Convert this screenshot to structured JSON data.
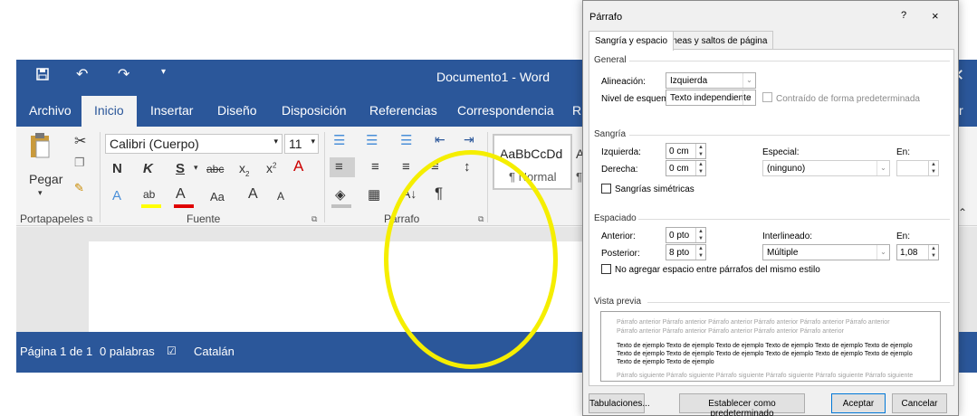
{
  "word": {
    "title": "Documento1 - Word",
    "quick_access": [
      "save-icon",
      "undo-icon",
      "redo-icon",
      "customize-icon"
    ],
    "tabs": [
      "Archivo",
      "Inicio",
      "Insertar",
      "Diseño",
      "Disposición",
      "Referencias",
      "Correspondencia",
      "R"
    ],
    "active_tab": "Inicio",
    "tab_overflow_text": "tir",
    "ribbon": {
      "paste_label": "Pegar",
      "font_name": "Calibri (Cuerpo)",
      "font_size": "11",
      "style_sample": "AaBbCcDd",
      "style_sample_partial": "A",
      "style_name": "¶ Normal",
      "style_name_partial": "¶",
      "groups": {
        "clipboard": "Portapapeles",
        "font": "Fuente",
        "paragraph": "Párrafo"
      }
    },
    "status": {
      "page": "Página 1 de 1",
      "words": "0 palabras",
      "language": "Catalán",
      "zoom_partial": "%"
    }
  },
  "dialog": {
    "title": "Párrafo",
    "help": "?",
    "close": "×",
    "tabs": [
      "Sangría y espacio",
      "Líneas y saltos de página"
    ],
    "general": {
      "section": "General",
      "alignment_label": "Alineación:",
      "alignment_value": "Izquierda",
      "outline_label": "Nivel de esquema:",
      "outline_value": "Texto independiente",
      "collapsed_label": "Contraído de forma predeterminada"
    },
    "indent": {
      "section": "Sangría",
      "left_label": "Izquierda:",
      "left_value": "0 cm",
      "right_label": "Derecha:",
      "right_value": "0 cm",
      "special_label": "Especial:",
      "special_value": "(ninguno)",
      "by_label": "En:",
      "by_value": "",
      "mirror_label": "Sangrías simétricas"
    },
    "spacing": {
      "section": "Espaciado",
      "before_label": "Anterior:",
      "before_value": "0 pto",
      "after_label": "Posterior:",
      "after_value": "8 pto",
      "line_label": "Interlineado:",
      "line_value": "Múltiple",
      "at_label": "En:",
      "at_value": "1,08",
      "no_space_label": "No agregar espacio entre párrafos del mismo estilo"
    },
    "preview": {
      "section": "Vista previa",
      "prev_lines": [
        "Párrafo anterior Párrafo anterior Párrafo anterior Párrafo anterior Párrafo anterior Párrafo anterior",
        "Párrafo anterior Párrafo anterior Párrafo anterior Párrafo anterior Párrafo anterior"
      ],
      "sample_lines": [
        "Texto de ejemplo Texto de ejemplo Texto de ejemplo Texto de ejemplo Texto de ejemplo Texto de ejemplo",
        "Texto de ejemplo Texto de ejemplo Texto de ejemplo Texto de ejemplo Texto de ejemplo Texto de ejemplo",
        "Texto de ejemplo Texto de ejemplo"
      ],
      "next_line": "Párrafo siguiente Párrafo siguiente Párrafo siguiente Párrafo siguiente Párrafo siguiente Párrafo siguiente"
    },
    "buttons": {
      "tabs": "Tabulaciones...",
      "default": "Establecer como predeterminado",
      "ok": "Aceptar",
      "cancel": "Cancelar"
    }
  },
  "annotation": {
    "color": "#f5ee00",
    "shape": "circle"
  },
  "colors": {
    "word_blue": "#2b579a",
    "ribbon_bg": "#f3f3f3",
    "dialog_bg": "#f0f0f0"
  }
}
